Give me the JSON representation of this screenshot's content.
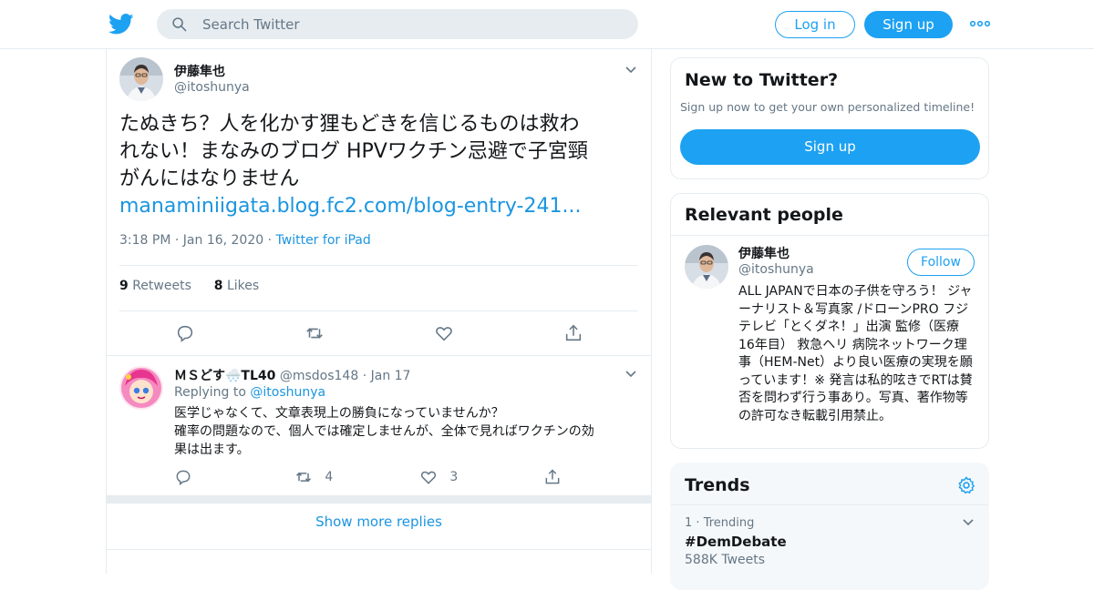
{
  "header": {
    "search_placeholder": "Search Twitter",
    "login_label": "Log in",
    "signup_label": "Sign up"
  },
  "tweet": {
    "author_name": "伊藤隼也",
    "author_handle": "@itoshunya",
    "text_line1": "たぬきち？人を化かす狸もどきを信じるものは救わ",
    "text_line2": "れない！まなみのブログ HPVワクチン忌避で子宮頸",
    "text_line3": "がんにはなりません",
    "link": "manaminiigata.blog.fc2.com/blog-entry-241...",
    "time": "3:18 PM",
    "date": "Jan 16, 2020",
    "source": "Twitter for iPad",
    "retweets_count": "9",
    "retweets_label": "Retweets",
    "likes_count": "8",
    "likes_label": "Likes"
  },
  "reply": {
    "author_name": "ＭＳどす🌨️TL40",
    "author_handle": "@msdos148",
    "date": "Jan 17",
    "replying_prefix": "Replying to",
    "replying_to": "@itoshunya",
    "text_line1": "医学じゃなくて、文章表現上の勝負になっていませんか？",
    "text_line2": "確率の問題なので、個人では確定しませんが、全体で見ればワクチンの効",
    "text_line3": "果は出ます。",
    "retweets": "4",
    "likes": "3"
  },
  "show_more_replies": "Show more replies",
  "sidebar": {
    "new_to_twitter": {
      "title": "New to Twitter?",
      "subtitle": "Sign up now to get your own personalized timeline!",
      "signup_label": "Sign up"
    },
    "relevant_people": {
      "title": "Relevant people",
      "name": "伊藤隼也",
      "handle": "@itoshunya",
      "follow_label": "Follow",
      "bio": "ALL JAPANで日本の子供を守ろう！ ジャーナリスト＆写真家 /ドローンPRO フジテレビ「とくダネ！」出演 監修（医療 16年目） 救急ヘリ 病院ネットワーク理事（HEM-Net）より良い医療の実現を願っています！※ 発言は私的呟きでRTは賛否を問わず行う事あり。写真、著作物等の許可なき転載引用禁止。"
    },
    "trends": {
      "title": "Trends",
      "items": [
        {
          "rank": "1",
          "label": "Trending",
          "name": "#DemDebate",
          "count": "588K Tweets"
        }
      ]
    }
  },
  "colors": {
    "accent": "#1da1f2",
    "link": "#1b95e0",
    "muted": "#657786",
    "border": "#e6ecf0"
  }
}
